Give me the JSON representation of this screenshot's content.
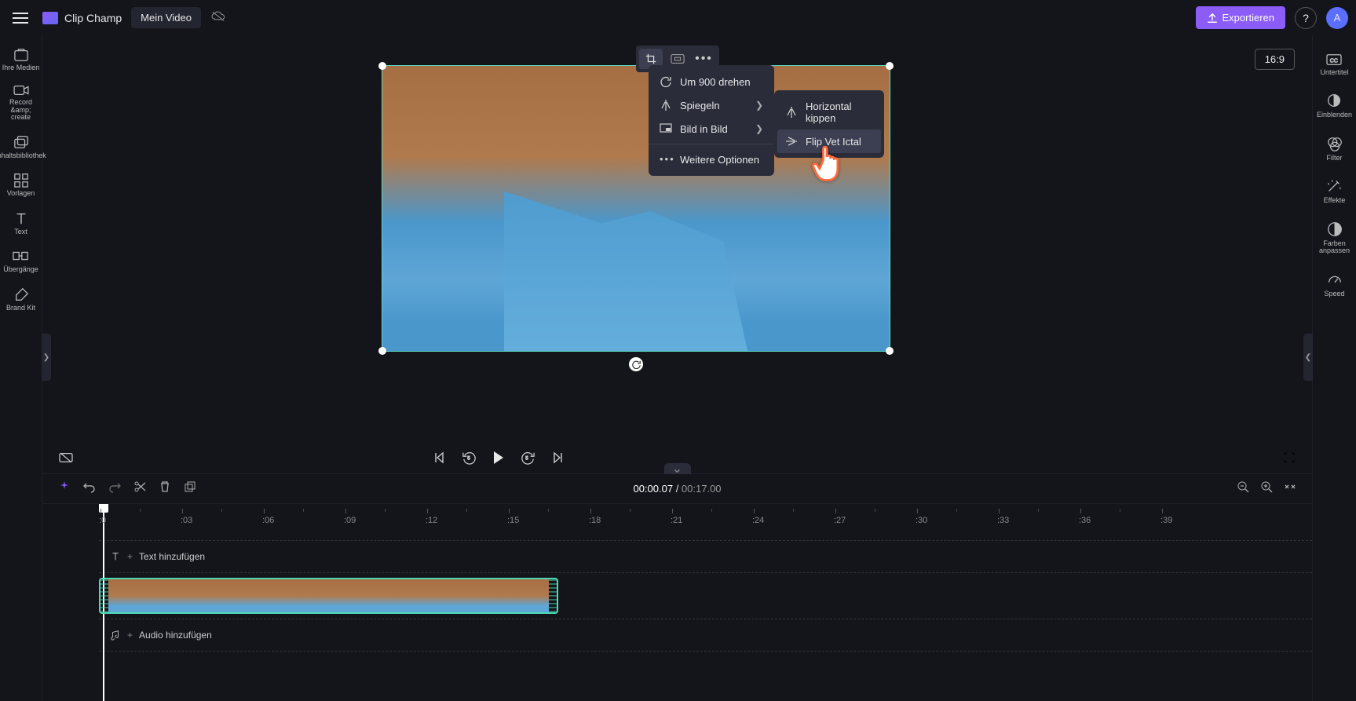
{
  "brand": "Clip Champ",
  "project_name": "Mein Video",
  "export_label": "Exportieren",
  "avatar_initial": "A",
  "left_rail": [
    {
      "id": "media",
      "label": "Ihre Medien"
    },
    {
      "id": "record",
      "label": "Record &amp; create"
    },
    {
      "id": "library",
      "label": "Inhaltsbibliothek"
    },
    {
      "id": "templates",
      "label": "Vorlagen"
    },
    {
      "id": "text",
      "label": "Text"
    },
    {
      "id": "transitions",
      "label": "Übergänge"
    },
    {
      "id": "brand",
      "label": "Brand Kit"
    }
  ],
  "right_rail": [
    {
      "id": "subs",
      "label": "Untertitel"
    },
    {
      "id": "fade",
      "label": "Einblenden"
    },
    {
      "id": "filter",
      "label": "Filter"
    },
    {
      "id": "effects",
      "label": "Effekte"
    },
    {
      "id": "color",
      "label": "Farben anpassen"
    },
    {
      "id": "speed",
      "label": "Speed"
    }
  ],
  "aspect_ratio": "16:9",
  "context_menu": {
    "rotate": "Um 900 drehen",
    "mirror": "Spiegeln",
    "pip": "Bild in Bild",
    "more": "Weitere Optionen"
  },
  "mirror_submenu": {
    "horizontal": "Horizontal kippen",
    "vertical": "Flip Vet Ictal"
  },
  "time": {
    "current": "00:00.07",
    "sep": " / ",
    "total": "00:17.00"
  },
  "timeline": {
    "ticks": [
      ":0",
      ":03",
      ":06",
      ":09",
      ":12",
      ":15",
      ":18",
      ":21",
      ":24",
      ":27",
      ":30",
      ":33",
      ":36",
      ":39"
    ]
  },
  "tracks": {
    "text_placeholder": "Text hinzufügen",
    "audio_placeholder": "Audio hinzufügen"
  },
  "colors": {
    "accent": "#8b5cf6",
    "selection": "#4dd9b4"
  }
}
